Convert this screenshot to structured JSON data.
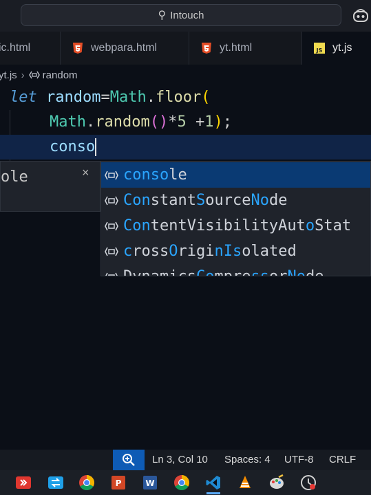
{
  "titlebar": {
    "search_label": "Intouch"
  },
  "tabs": [
    {
      "label": "ic.html",
      "type": "html"
    },
    {
      "label": "webpara.html",
      "type": "html"
    },
    {
      "label": "yt.html",
      "type": "html"
    },
    {
      "label": "yt.js",
      "type": "js",
      "active": true
    }
  ],
  "breadcrumb": {
    "file": "yt.js",
    "symbol": "random"
  },
  "editor": {
    "line1": {
      "kw": "let",
      "var": "random",
      "eq": "=",
      "cls": "Math",
      "dot": ".",
      "fn": "floor",
      "paren": "("
    },
    "line2": {
      "cls": "Math",
      "dot": ".",
      "fn": "random",
      "call": "()",
      "op": "*",
      "num1": "5",
      "plus": " +",
      "num2": "1",
      "close": ")",
      "semi": ";"
    },
    "line3": {
      "typed": "conso"
    }
  },
  "detail_panel": {
    "text": "ole",
    "close": "×"
  },
  "suggestions": [
    {
      "match": "conso",
      "rest": "le",
      "selected": true
    },
    {
      "parts": [
        "Con",
        "stant",
        "S",
        "ource",
        "No",
        "de"
      ]
    },
    {
      "parts": [
        "Con",
        "tentVisibilityAut",
        "o",
        "Stat"
      ]
    },
    {
      "parts": [
        "c",
        "ross",
        "O",
        "rigi",
        "n",
        "I",
        "s",
        "olated"
      ]
    },
    {
      "parts": [
        "Dynamics",
        "Co",
        "mpre",
        "s",
        "s",
        "or",
        "No",
        "de"
      ]
    }
  ],
  "statusbar": {
    "position": "Ln 3, Col 10",
    "spaces": "Spaces: 4",
    "encoding": "UTF-8",
    "eol": "CRLF"
  },
  "colors": {
    "accent": "#0e5bb5",
    "selection": "#0a3a73",
    "match_highlight": "#2aa5ff",
    "current_line": "#102447"
  }
}
